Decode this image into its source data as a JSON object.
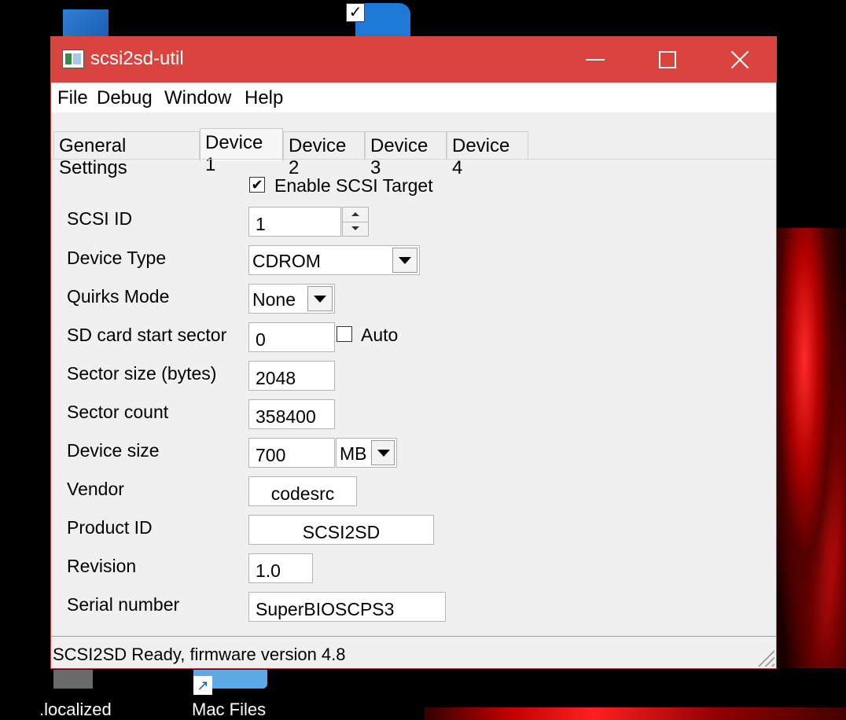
{
  "desktop": {
    "icons": [
      {
        "name": "localized-folder-icon",
        "label": ".localized"
      },
      {
        "name": "mac-files-folder-icon",
        "label": "Mac Files"
      }
    ]
  },
  "window": {
    "title": "scsi2sd-util",
    "menu": [
      "File",
      "Debug",
      "Window",
      "Help"
    ],
    "tabs": [
      {
        "label": "General Settings",
        "active": false
      },
      {
        "label": "Device 1",
        "active": true
      },
      {
        "label": "Device 2",
        "active": false
      },
      {
        "label": "Device 3",
        "active": false
      },
      {
        "label": "Device 4",
        "active": false
      }
    ],
    "form": {
      "enable_label": "Enable SCSI Target",
      "enable_checked": true,
      "scsi_id_label": "SCSI ID",
      "scsi_id_value": "1",
      "device_type_label": "Device Type",
      "device_type_value": "CDROM",
      "quirks_label": "Quirks Mode",
      "quirks_value": "None",
      "start_sector_label": "SD card start sector",
      "start_sector_value": "0",
      "auto_label": "Auto",
      "auto_checked": false,
      "sector_size_label": "Sector size (bytes)",
      "sector_size_value": "2048",
      "sector_count_label": "Sector count",
      "sector_count_value": "358400",
      "device_size_label": "Device size",
      "device_size_value": "700",
      "device_size_unit": "MB",
      "vendor_label": "Vendor",
      "vendor_value": "codesrc",
      "product_label": "Product ID",
      "product_value": "SCSI2SD",
      "revision_label": "Revision",
      "revision_value": "1.0",
      "serial_label": "Serial number",
      "serial_value": "SuperBIOSCPS3"
    },
    "status": "SCSI2SD Ready, firmware version 4.8"
  }
}
